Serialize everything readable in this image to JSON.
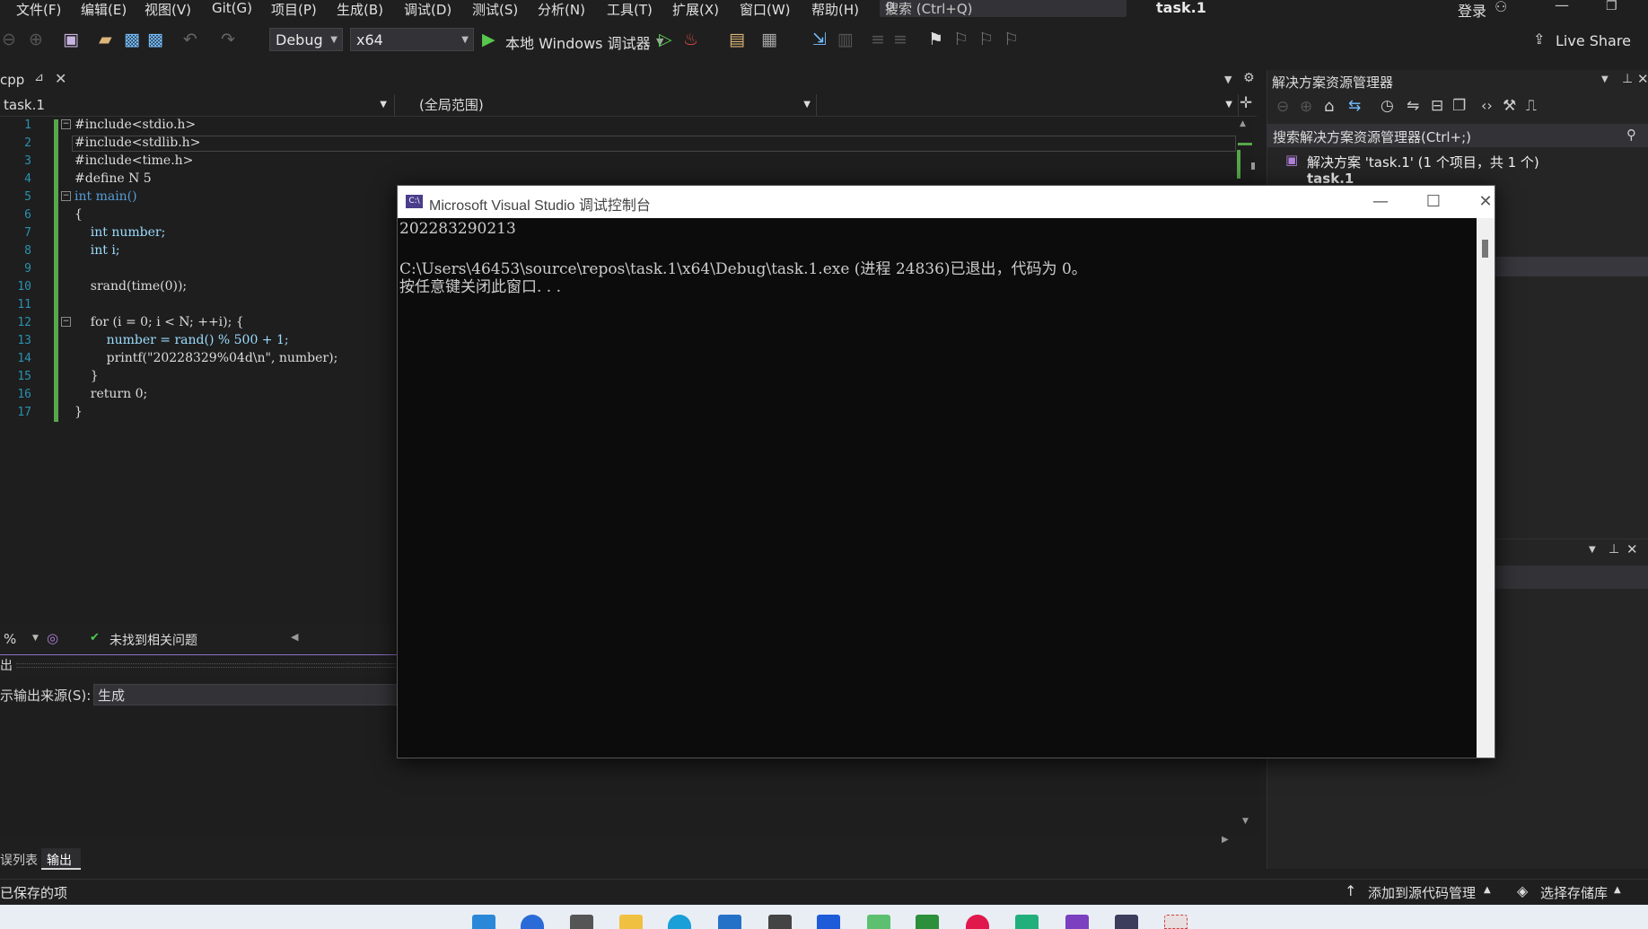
{
  "menubar": {
    "items": [
      "文件(F)",
      "编辑(E)",
      "视图(V)",
      "Git(G)",
      "项目(P)",
      "生成(B)",
      "调试(D)",
      "测试(S)",
      "分析(N)",
      "工具(T)",
      "扩展(X)",
      "窗口(W)",
      "帮助(H)"
    ],
    "search_placeholder": "搜索 (Ctrl+Q)",
    "window_title": "task.1",
    "login": "登录"
  },
  "toolbar": {
    "config": "Debug",
    "platform": "x64",
    "run_label": "本地 Windows 调试器",
    "live_share": "Live Share"
  },
  "editor": {
    "tab_label": "cpp",
    "nav_project": "task.1",
    "nav_scope": "(全局范围)",
    "lines": [
      {
        "n": "1",
        "code": "#include<stdio.h>"
      },
      {
        "n": "2",
        "code": "#include<stdlib.h>"
      },
      {
        "n": "3",
        "code": "#include<time.h>"
      },
      {
        "n": "4",
        "code": "#define N 5"
      },
      {
        "n": "5",
        "code": "int main()"
      },
      {
        "n": "6",
        "code": "{"
      },
      {
        "n": "7",
        "code": "    int number;"
      },
      {
        "n": "8",
        "code": "    int i;"
      },
      {
        "n": "9",
        "code": ""
      },
      {
        "n": "10",
        "code": "    srand(time(0));"
      },
      {
        "n": "11",
        "code": ""
      },
      {
        "n": "12",
        "code": "    for (i = 0; i < N; ++i); {"
      },
      {
        "n": "13",
        "code": "        number = rand() % 500 + 1;"
      },
      {
        "n": "14",
        "code": "        printf(\"20228329%04d\\n\", number);"
      },
      {
        "n": "15",
        "code": "    }"
      },
      {
        "n": "16",
        "code": "    return 0;"
      },
      {
        "n": "17",
        "code": "}"
      }
    ],
    "zoom": "%",
    "issues": "未找到相关问题"
  },
  "output": {
    "title": "出",
    "source_label": "示输出来源(S):",
    "source_value": "生成",
    "tabs": [
      "误列表",
      "输出"
    ]
  },
  "solution": {
    "title": "解决方案资源管理器",
    "search_placeholder": "搜索解决方案资源管理器(Ctrl+;)",
    "solution_item": "解决方案 'task.1' (1 个项目，共 1 个)",
    "project_item": "task.1"
  },
  "status": {
    "left": "已保存的项",
    "source_control": "添加到源代码管理",
    "repo": "选择存储库"
  },
  "console": {
    "title": "Microsoft Visual Studio 调试控制台",
    "lines": [
      "202283290213",
      "",
      "C:\\Users\\46453\\source\\repos\\task.1\\x64\\Debug\\task.1.exe (进程 24836)已退出，代码为 0。",
      "按任意键关闭此窗口. . ."
    ]
  },
  "colors": {
    "bg": "#1e1e1e",
    "accent": "#68217a",
    "line_number": "#2b91af",
    "change_bar": "#57a64a"
  }
}
